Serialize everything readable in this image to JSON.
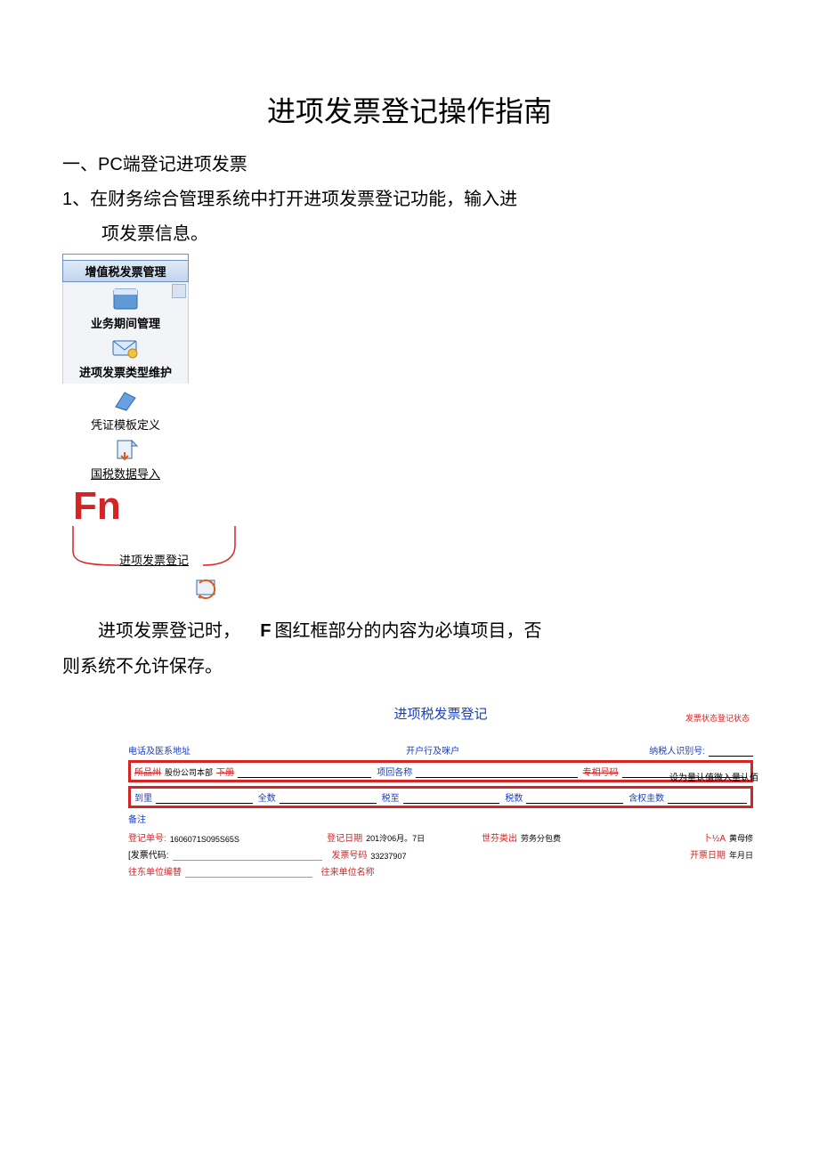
{
  "title": "进项发票登记操作指南",
  "section1": "一、PC端登记进项发票",
  "step1": "1、在财务综合管理系统中打开进项发票登记功能，输入进",
  "step1_cont": "项发票信息。",
  "sidebar": {
    "header": "增值税发票管理",
    "items": [
      {
        "label": "业务期间管理"
      },
      {
        "label": "进项发票类型维护"
      },
      {
        "label": "凭证模板定义"
      },
      {
        "label": "国税数据导入"
      }
    ],
    "fn": "Fn",
    "target": "进项发票登记"
  },
  "para2_a": "进项发票登记时，",
  "para2_bigF": "F",
  "para2_b": "图红框部分的内容为必填项目，否",
  "para2_c": "则系统不允许保存。",
  "form": {
    "title": "进项税发票登记",
    "status": "发票状态登记状态",
    "row1": {
      "tel": "电话及医系地址",
      "bank": "开户行及咪户",
      "taxid": "纳税人识别号:"
    },
    "row_red1": {
      "left_strike": "所品州",
      "left_val": "股份公司本部",
      "left_suffix": "下册",
      "mid": "项回各称",
      "right_strike": "专相号码",
      "suffix": "设为量认值微入量认佰"
    },
    "row_red2": {
      "f1": "到里",
      "f2": "全数",
      "f3": "税至",
      "f4": "税数",
      "f5": "含权圭数"
    },
    "remark": "备注",
    "info1": {
      "reg_no_lbl": "登记单号:",
      "reg_no_val": "1606071S095S65S",
      "reg_date_lbl": "登记日期",
      "reg_date_val": "201泠06月。7日",
      "type_lbl": "世芬类出",
      "type_val": "劳务分包费",
      "op_lbl": "卜½A",
      "op_val": "黄母修"
    },
    "info2": {
      "inv_code_lbl": "[发票代码:",
      "inv_no_lbl": "发票号码",
      "inv_no_val": "33237907",
      "inv_date_lbl": "开票日期",
      "inv_date_val": "年月日"
    },
    "info3": {
      "unit_code": "往东单位编替",
      "unit_name": "往来单位名称"
    }
  }
}
